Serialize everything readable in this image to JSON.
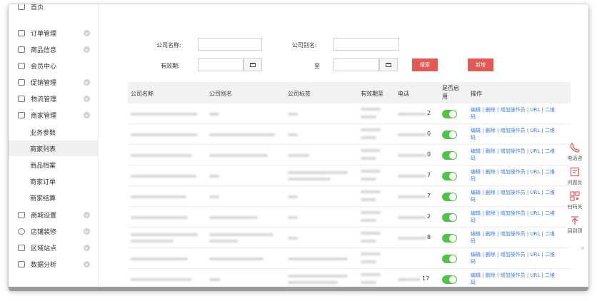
{
  "sidebar": {
    "top_partial": "首页",
    "items": [
      {
        "label": "订单管理",
        "icon": "clipboard-icon"
      },
      {
        "label": "商品信息",
        "icon": "box-icon"
      },
      {
        "label": "会员中心",
        "icon": "member-card-icon"
      },
      {
        "label": "促销管理",
        "icon": "promotion-icon"
      },
      {
        "label": "物流管理",
        "icon": "truck-icon"
      },
      {
        "label": "商家管理",
        "icon": "merchant-icon"
      }
    ],
    "sub_items": [
      "业务参数",
      "商家列表",
      "商品档案",
      "商家订单",
      "商家结算"
    ],
    "active_sub": "商家列表",
    "bottom_items": [
      {
        "label": "商城设置",
        "icon": "store-settings-icon"
      },
      {
        "label": "店铺装修",
        "icon": "decoration-icon"
      },
      {
        "label": "区域站点",
        "icon": "site-icon"
      },
      {
        "label": "数据分析",
        "icon": "chart-icon"
      }
    ]
  },
  "filters": {
    "company_name_label": "公司名称:",
    "company_alias_label": "公司别名:",
    "validity_label": "有效期:",
    "to_label": "至",
    "search_button": "搜索",
    "add_button": "新增"
  },
  "table": {
    "headers": [
      "公司名称",
      "公司别名",
      "公司标签",
      "有效期至",
      "电话",
      "是否启用",
      "操作"
    ],
    "enabled_header_line1": "是否启",
    "enabled_header_line2": "用",
    "rows": [
      {
        "phone_tail": "2",
        "enabled": true
      },
      {
        "phone_tail": "0",
        "enabled": true
      },
      {
        "phone_tail": "0",
        "enabled": true
      },
      {
        "phone_tail": "7",
        "enabled": true
      },
      {
        "phone_tail": "7",
        "enabled": true
      },
      {
        "phone_tail": "2",
        "enabled": true
      },
      {
        "phone_tail": "8",
        "enabled": true
      },
      {
        "phone_tail": "",
        "enabled": true
      },
      {
        "phone_tail": "17",
        "enabled": true
      }
    ],
    "ops_line1": "编辑 | 删除 | 增加操作员 | URL | 二维",
    "ops_line2": "码"
  },
  "floating_tools": [
    {
      "label": "电话咨",
      "icon": "phone-icon"
    },
    {
      "label": "问题反",
      "icon": "feedback-icon"
    },
    {
      "label": "扫码关",
      "icon": "qrcode-icon"
    },
    {
      "label": "回到顶",
      "icon": "back-to-top-icon"
    }
  ],
  "close_label": "×",
  "colors": {
    "accent_red": "#e25a55",
    "toggle_green": "#52c34a",
    "link_blue": "#3b7ad8",
    "tool_red": "#e25a55"
  }
}
